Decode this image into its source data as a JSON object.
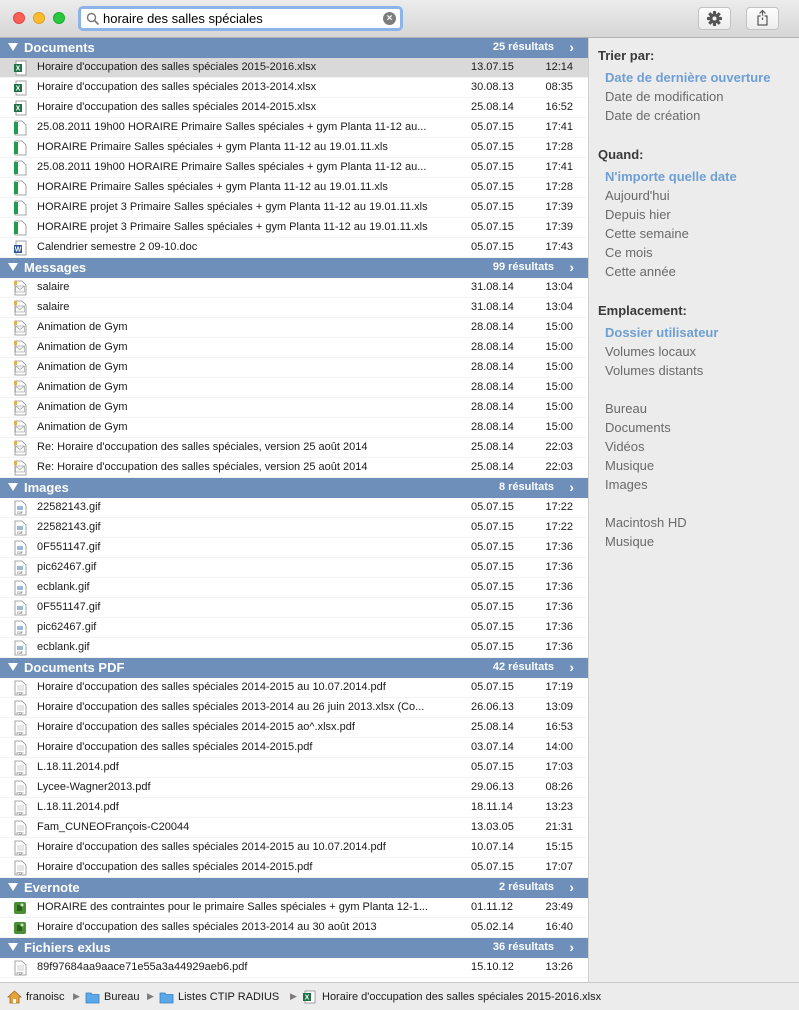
{
  "search": {
    "query": "horaire des salles spéciales"
  },
  "groups": [
    {
      "title": "Documents",
      "count": "25 résultats",
      "rows": [
        {
          "name": "Horaire d'occupation des salles spéciales 2015-2016.xlsx",
          "date": "13.07.15",
          "time": "12:14",
          "icon": "excel",
          "selected": true
        },
        {
          "name": "Horaire d'occupation des salles spéciales 2013-2014.xlsx",
          "date": "30.08.13",
          "time": "08:35",
          "icon": "excel"
        },
        {
          "name": "Horaire d'occupation des salles spéciales 2014-2015.xlsx",
          "date": "25.08.14",
          "time": "16:52",
          "icon": "excel"
        },
        {
          "name": "25.08.2011 19h00 HORAIRE Primaire Salles spéciales + gym Planta 11-12 au...",
          "date": "05.07.15",
          "time": "17:41",
          "icon": "sheet"
        },
        {
          "name": "HORAIRE Primaire Salles spéciales + gym Planta 11-12 au 19.01.11.xls",
          "date": "05.07.15",
          "time": "17:28",
          "icon": "sheet"
        },
        {
          "name": "25.08.2011 19h00 HORAIRE Primaire Salles spéciales + gym Planta 11-12 au...",
          "date": "05.07.15",
          "time": "17:41",
          "icon": "sheet"
        },
        {
          "name": "HORAIRE Primaire Salles spéciales + gym Planta 11-12 au 19.01.11.xls",
          "date": "05.07.15",
          "time": "17:28",
          "icon": "sheet"
        },
        {
          "name": "HORAIRE projet 3 Primaire Salles spéciales + gym Planta 11-12 au 19.01.11.xls",
          "date": "05.07.15",
          "time": "17:39",
          "icon": "sheet"
        },
        {
          "name": "HORAIRE projet 3 Primaire Salles spéciales + gym Planta 11-12 au 19.01.11.xls",
          "date": "05.07.15",
          "time": "17:39",
          "icon": "sheet"
        },
        {
          "name": "Calendrier semestre 2 09-10.doc",
          "date": "05.07.15",
          "time": "17:43",
          "icon": "word"
        }
      ]
    },
    {
      "title": "Messages",
      "count": "99 résultats",
      "rows": [
        {
          "name": "salaire",
          "date": "31.08.14",
          "time": "13:04",
          "icon": "mail"
        },
        {
          "name": "salaire",
          "date": "31.08.14",
          "time": "13:04",
          "icon": "mail"
        },
        {
          "name": "Animation de Gym",
          "date": "28.08.14",
          "time": "15:00",
          "icon": "mail"
        },
        {
          "name": "Animation de Gym",
          "date": "28.08.14",
          "time": "15:00",
          "icon": "mail"
        },
        {
          "name": "Animation de Gym",
          "date": "28.08.14",
          "time": "15:00",
          "icon": "mail"
        },
        {
          "name": "Animation de Gym",
          "date": "28.08.14",
          "time": "15:00",
          "icon": "mail"
        },
        {
          "name": "Animation de Gym",
          "date": "28.08.14",
          "time": "15:00",
          "icon": "mail"
        },
        {
          "name": "Animation de Gym",
          "date": "28.08.14",
          "time": "15:00",
          "icon": "mail"
        },
        {
          "name": "Re: Horaire d'occupation des salles spéciales, version 25 août 2014",
          "date": "25.08.14",
          "time": "22:03",
          "icon": "mail"
        },
        {
          "name": "Re: Horaire d'occupation des salles spéciales, version 25 août 2014",
          "date": "25.08.14",
          "time": "22:03",
          "icon": "mail"
        }
      ]
    },
    {
      "title": "Images",
      "count": "8 résultats",
      "rows": [
        {
          "name": "22582143.gif",
          "date": "05.07.15",
          "time": "17:22",
          "icon": "gif"
        },
        {
          "name": "22582143.gif",
          "date": "05.07.15",
          "time": "17:22",
          "icon": "gif"
        },
        {
          "name": "0F551147.gif",
          "date": "05.07.15",
          "time": "17:36",
          "icon": "gif"
        },
        {
          "name": "pic62467.gif",
          "date": "05.07.15",
          "time": "17:36",
          "icon": "gif"
        },
        {
          "name": "ecblank.gif",
          "date": "05.07.15",
          "time": "17:36",
          "icon": "gif"
        },
        {
          "name": "0F551147.gif",
          "date": "05.07.15",
          "time": "17:36",
          "icon": "gif"
        },
        {
          "name": "pic62467.gif",
          "date": "05.07.15",
          "time": "17:36",
          "icon": "gif"
        },
        {
          "name": "ecblank.gif",
          "date": "05.07.15",
          "time": "17:36",
          "icon": "gif"
        }
      ]
    },
    {
      "title": "Documents PDF",
      "count": "42 résultats",
      "rows": [
        {
          "name": "Horaire d'occupation des salles spéciales 2014-2015 au 10.07.2014.pdf",
          "date": "05.07.15",
          "time": "17:19",
          "icon": "pdf"
        },
        {
          "name": "Horaire d'occupation des salles spéciales 2013-2014 au 26 juin 2013.xlsx (Co...",
          "date": "26.06.13",
          "time": "13:09",
          "icon": "pdf"
        },
        {
          "name": "Horaire d'occupation des salles spéciales 2014-2015 ao^.xlsx.pdf",
          "date": "25.08.14",
          "time": "16:53",
          "icon": "pdf"
        },
        {
          "name": "Horaire d'occupation des salles spéciales 2014-2015.pdf",
          "date": "03.07.14",
          "time": "14:00",
          "icon": "pdf"
        },
        {
          "name": "L.18.11.2014.pdf",
          "date": "05.07.15",
          "time": "17:03",
          "icon": "pdf"
        },
        {
          "name": "Lycee-Wagner2013.pdf",
          "date": "29.06.13",
          "time": "08:26",
          "icon": "pdf"
        },
        {
          "name": "L.18.11.2014.pdf",
          "date": "18.11.14",
          "time": "13:23",
          "icon": "pdf"
        },
        {
          "name": "Fam_CUNEOFrançois-C20044",
          "date": "13.03.05",
          "time": "21:31",
          "icon": "pdf"
        },
        {
          "name": "Horaire d'occupation des salles spéciales 2014-2015 au 10.07.2014.pdf",
          "date": "10.07.14",
          "time": "15:15",
          "icon": "pdf"
        },
        {
          "name": "Horaire d'occupation des salles spéciales 2014-2015.pdf",
          "date": "05.07.15",
          "time": "17:07",
          "icon": "pdf"
        }
      ]
    },
    {
      "title": "Evernote",
      "count": "2 résultats",
      "rows": [
        {
          "name": "HORAIRE des contraintes pour le  primaire Salles spéciales + gym Planta 12-1...",
          "date": "01.11.12",
          "time": "23:49",
          "icon": "evernote"
        },
        {
          "name": "Horaire d'occupation des salles spéciales 2013-2014 au 30 août 2013",
          "date": "05.02.14",
          "time": "16:40",
          "icon": "evernote"
        }
      ]
    },
    {
      "title": "Fichiers exlus",
      "count": "36 résultats",
      "rows": [
        {
          "name": "89f97684aa9aace71e55a3a44929aeb6.pdf",
          "date": "15.10.12",
          "time": "13:26",
          "icon": "pdf"
        }
      ]
    }
  ],
  "sidebar": {
    "sort_heading": "Trier par:",
    "sort_items": [
      "Date de dernière ouverture",
      "Date de modification",
      "Date de création"
    ],
    "when_heading": "Quand:",
    "when_items": [
      "N'importe quelle date",
      "Aujourd'hui",
      "Depuis hier",
      "Cette semaine",
      "Ce mois",
      "Cette année"
    ],
    "location_heading": "Emplacement:",
    "location_items": [
      "Dossier utilisateur",
      "Volumes locaux",
      "Volumes distants"
    ],
    "folder_items": [
      "Bureau",
      "Documents",
      "Vidéos",
      "Musique",
      "Images"
    ],
    "volume_items": [
      "Macintosh HD",
      "Musique"
    ]
  },
  "path": [
    "franoisc",
    "Bureau",
    "Listes CTIP RADIUS",
    "Horaire d'occupation des salles spéciales 2015-2016.xlsx"
  ],
  "colors": {
    "group_header": "#6e8fba",
    "active_filter": "#6e9fd4",
    "search_focus": "#8db3e8"
  }
}
